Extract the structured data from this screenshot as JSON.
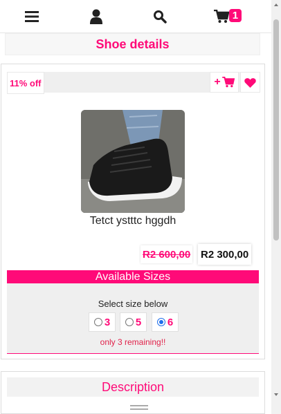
{
  "header": {
    "menu_icon": "hamburger-menu-icon",
    "user_icon": "user-icon",
    "search_icon": "search-icon",
    "cart_icon": "cart-icon",
    "cart_count": "1"
  },
  "page_title": "Shoe details",
  "product": {
    "discount": "11% off",
    "add_to_cart_label": "+",
    "name": "Tetct ystttc hggdh",
    "old_price": "R2 600,00",
    "new_price": "R2 300,00"
  },
  "sizes": {
    "title": "Available Sizes",
    "caption": "Select size below",
    "options": [
      {
        "label": "3",
        "selected": false
      },
      {
        "label": "5",
        "selected": false
      },
      {
        "label": "6",
        "selected": true
      }
    ],
    "remaining": "only 3 remaining!!"
  },
  "description": {
    "title": "Description"
  },
  "colors": {
    "accent": "#ff0a78",
    "radio_selected": "#1f6feb"
  }
}
